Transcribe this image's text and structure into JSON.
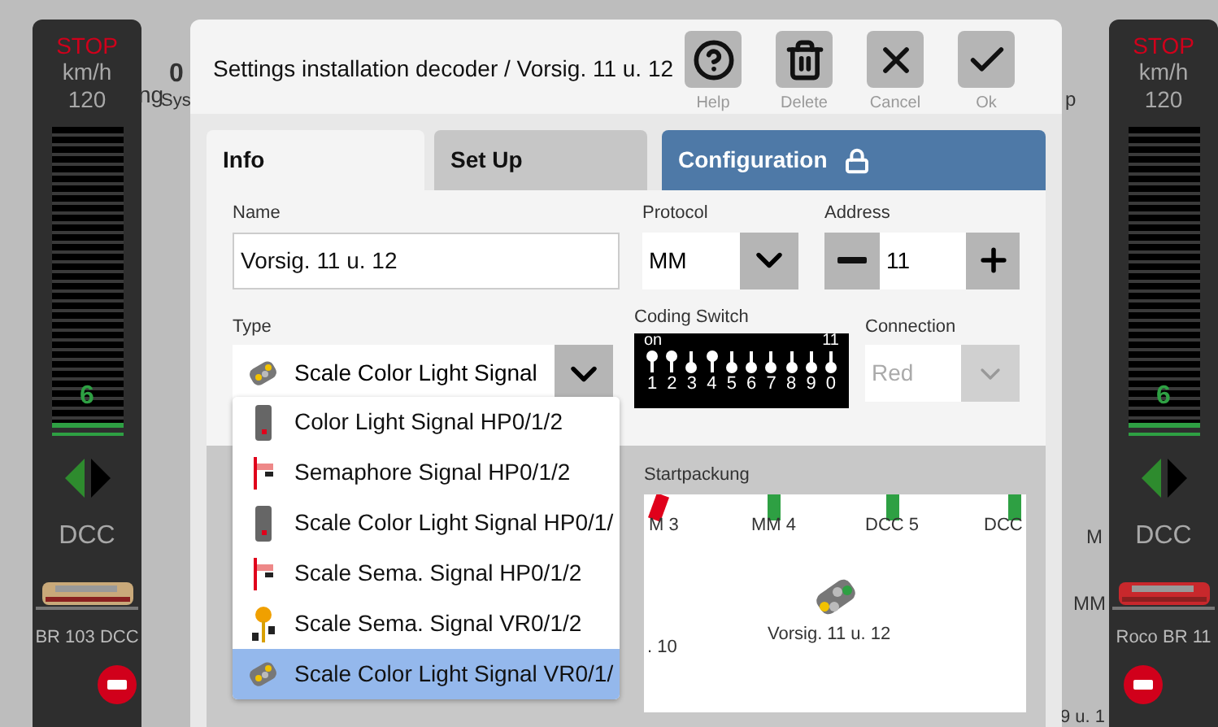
{
  "background_texts": [
    "0",
    "ng",
    "Sys",
    "p",
    "M",
    "MM",
    "9 u. 1"
  ],
  "loco_panels": [
    {
      "stop": "STOP",
      "unit": "km/h",
      "max": "120",
      "speed": "6",
      "level": 0.04,
      "left_active": true,
      "protocol": "DCC",
      "name": "BR 103 DCC"
    },
    {
      "stop": "STOP",
      "unit": "km/h",
      "max": "120",
      "speed": "6",
      "level": 0.04,
      "left_active": true,
      "protocol": "DCC",
      "name": "Roco BR 11"
    }
  ],
  "dialog": {
    "title": "Settings installation decoder / Vorsig. 11 u. 12",
    "buttons": [
      {
        "kind": "help",
        "label": "Help"
      },
      {
        "kind": "delete",
        "label": "Delete"
      },
      {
        "kind": "cancel",
        "label": "Cancel"
      },
      {
        "kind": "ok",
        "label": "Ok"
      }
    ],
    "tabs": [
      {
        "label": "Info",
        "selected": true,
        "locked": false
      },
      {
        "label": "Set Up",
        "selected": false,
        "locked": false
      },
      {
        "label": "Configuration",
        "selected": false,
        "locked": true
      }
    ],
    "name": {
      "label": "Name",
      "value": "Vorsig. 11 u. 12"
    },
    "protocol": {
      "label": "Protocol",
      "value": "MM"
    },
    "address": {
      "label": "Address",
      "value": "11"
    },
    "type": {
      "label": "Type",
      "value": "Scale Color Light Signal",
      "kind": "scale_color_distant"
    },
    "coding_switch": {
      "label": "Coding Switch",
      "on_label": "on",
      "address": "11",
      "switches": [
        {
          "number": "1",
          "on": true
        },
        {
          "number": "2",
          "on": true
        },
        {
          "number": "3",
          "on": false
        },
        {
          "number": "4",
          "on": true
        },
        {
          "number": "5",
          "on": false
        },
        {
          "number": "6",
          "on": false
        },
        {
          "number": "7",
          "on": false
        },
        {
          "number": "8",
          "on": false
        },
        {
          "number": "9",
          "on": false
        },
        {
          "number": "0",
          "on": false
        }
      ]
    },
    "connection": {
      "label": "Connection",
      "value": "Red",
      "disabled": true
    },
    "type_options": [
      {
        "label": "Color Light Signal HP0/1/2",
        "kind": "color_light",
        "selected": false
      },
      {
        "label": "Semaphore Signal HP0/1/2",
        "kind": "semaphore",
        "selected": false
      },
      {
        "label": "Scale Color Light Signal HP0/1/",
        "kind": "color_light",
        "selected": false
      },
      {
        "label": "Scale Sema. Signal HP0/1/2",
        "kind": "semaphore",
        "selected": false
      },
      {
        "label": "Scale Sema. Signal VR0/1/2",
        "kind": "sema_distant",
        "selected": false
      },
      {
        "label": "Scale Color Light Signal VR0/1/",
        "kind": "scale_color_distant",
        "selected": true
      }
    ],
    "layout": {
      "title": "Startpackung",
      "tracks": [
        {
          "label": "M 3",
          "color": "#e0001b"
        },
        {
          "label": "MM 4",
          "color": "#2ea043"
        },
        {
          "label": "DCC 5",
          "color": "#2ea043"
        },
        {
          "label": "DCC",
          "color": "#2ea043"
        }
      ],
      "side_label": ". 10",
      "signal_label": "Vorsig. 11 u. 12"
    }
  }
}
